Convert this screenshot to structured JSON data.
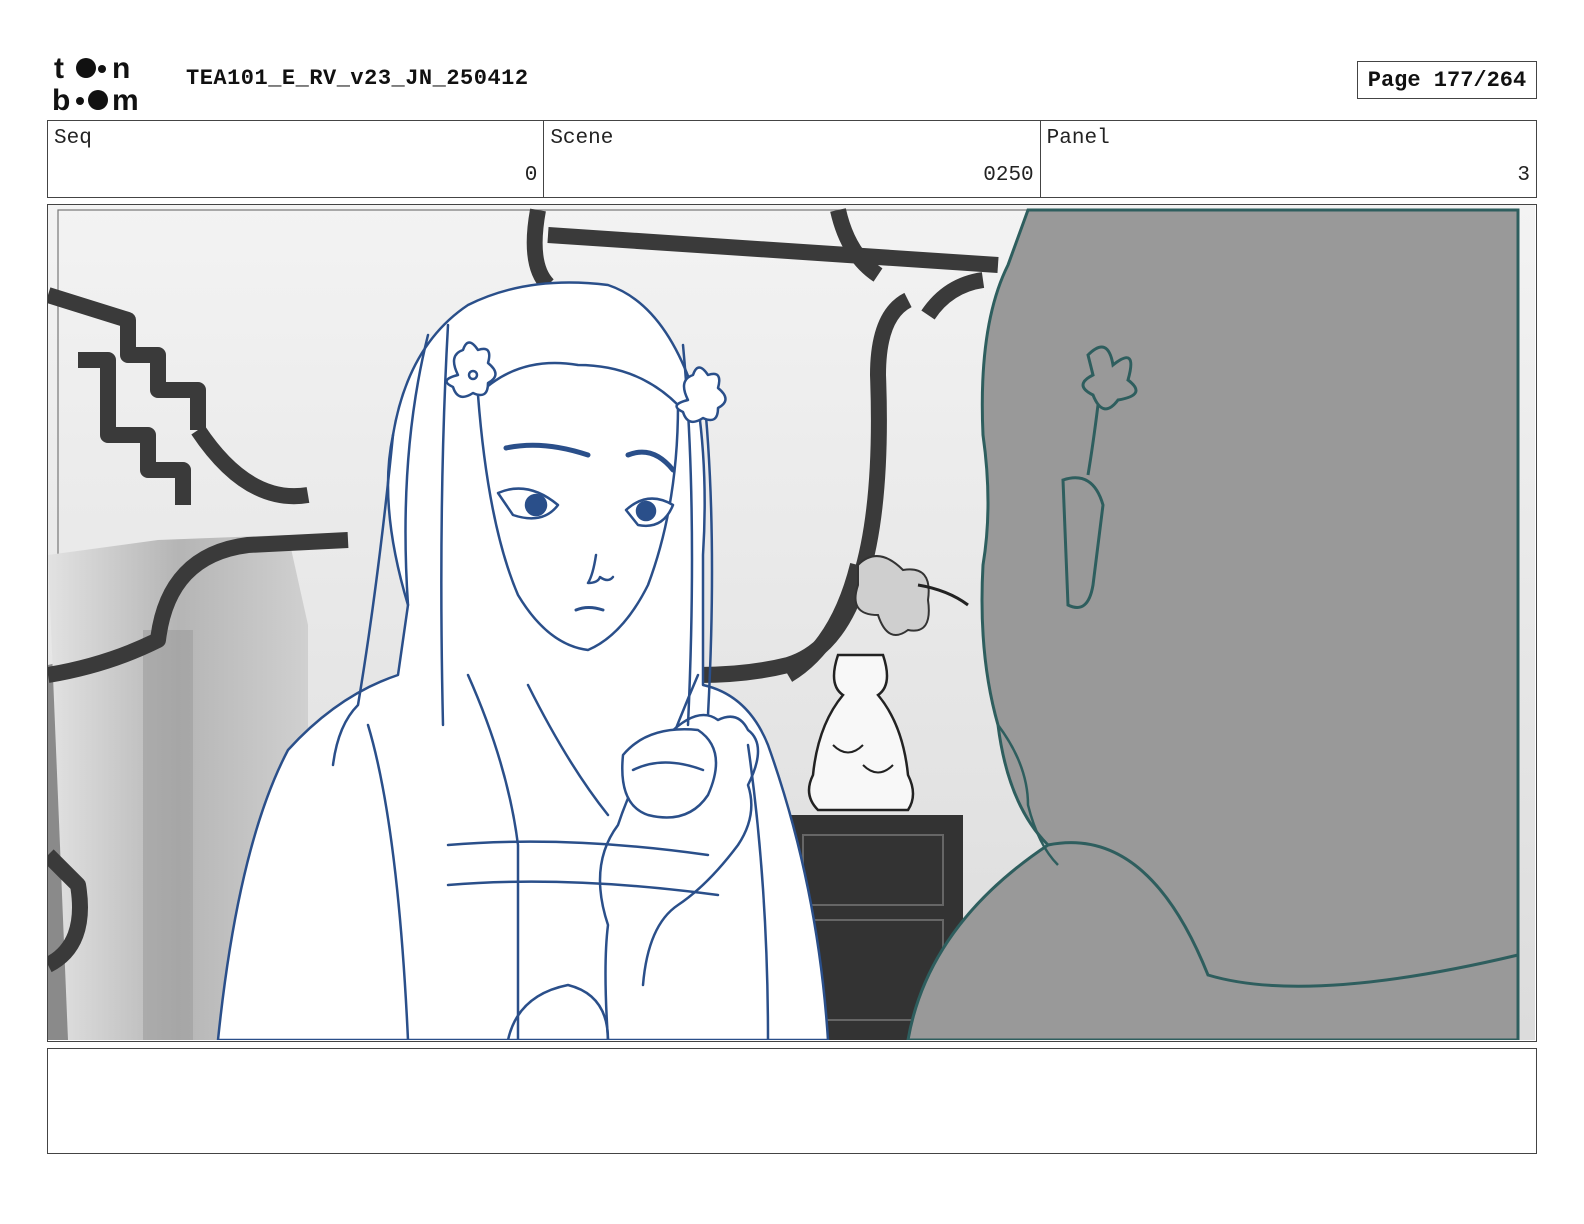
{
  "header": {
    "title": "TEA101_E_RV_v23_JN_250412",
    "page": "Page 177/264"
  },
  "fields": {
    "seq_label": "Seq",
    "seq_value": "0",
    "scene_label": "Scene",
    "scene_value": "0250",
    "panel_label": "Panel",
    "panel_value": "3"
  },
  "notes": {
    "text": ""
  },
  "colors": {
    "line_blue": "#2a4f8a",
    "line_teal": "#2e5e5e",
    "silhouette_gray": "#999999",
    "frame_dark": "#3a3a3a"
  }
}
